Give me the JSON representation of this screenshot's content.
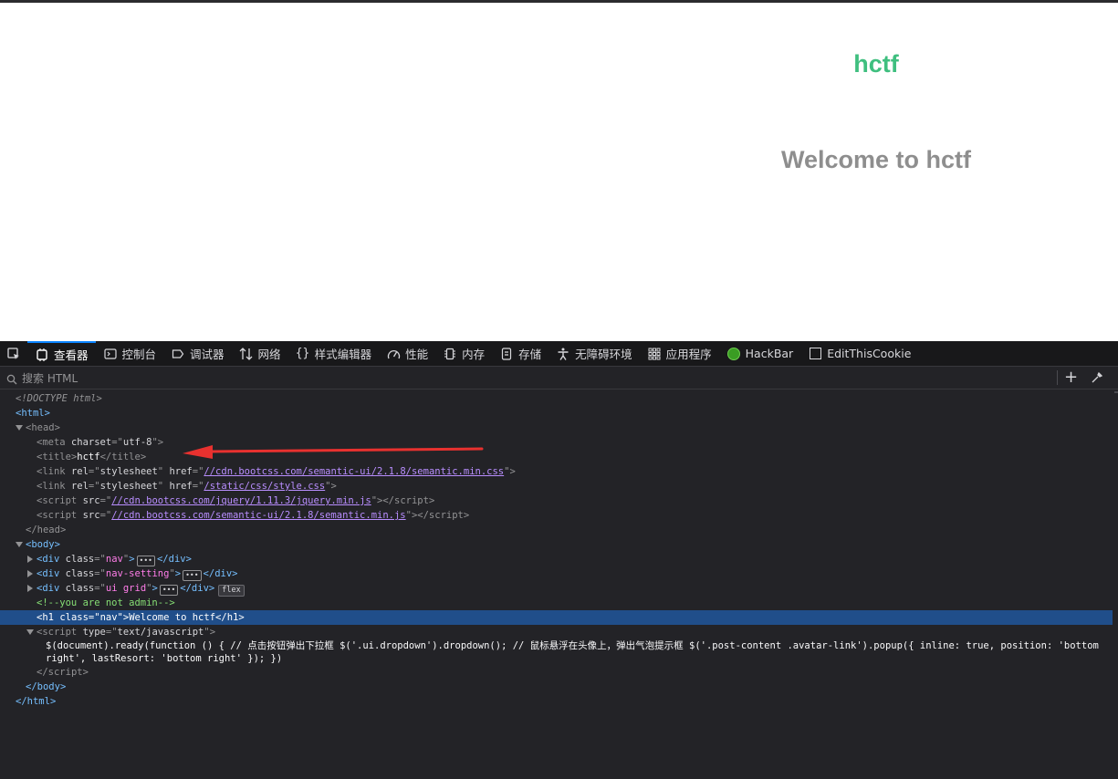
{
  "page": {
    "brand": "hctf",
    "heading": "Welcome to hctf",
    "colors": {
      "brand": "#3fbf7f",
      "heading": "#8e8e8e"
    }
  },
  "devtools": {
    "tabs": [
      {
        "label": "查看器",
        "icon": "inspector-icon",
        "active": true
      },
      {
        "label": "控制台",
        "icon": "console-icon"
      },
      {
        "label": "调试器",
        "icon": "debugger-icon"
      },
      {
        "label": "网络",
        "icon": "network-icon"
      },
      {
        "label": "样式编辑器",
        "icon": "style-editor-icon"
      },
      {
        "label": "性能",
        "icon": "performance-icon"
      },
      {
        "label": "内存",
        "icon": "memory-icon"
      },
      {
        "label": "存储",
        "icon": "storage-icon"
      },
      {
        "label": "无障碍环境",
        "icon": "accessibility-icon"
      },
      {
        "label": "应用程序",
        "icon": "application-icon"
      },
      {
        "label": "HackBar",
        "icon": "hackbar-icon"
      },
      {
        "label": "EditThisCookie",
        "icon": "cookie-icon"
      }
    ],
    "search": {
      "placeholder": "搜索 HTML"
    },
    "tree": {
      "doctype": "<!DOCTYPE html>",
      "t_html": "html",
      "t_head": "head",
      "t_meta": "meta",
      "a_charset": "charset",
      "v_charset": "utf-8",
      "t_title": "title",
      "title_text": "hctf",
      "t_link": "link",
      "a_rel": "rel",
      "v_stylesheet": "stylesheet",
      "a_href": "href",
      "v_css1": "//cdn.bootcss.com/semantic-ui/2.1.8/semantic.min.css",
      "v_css2": "/static/css/style.css",
      "t_script": "script",
      "a_src": "src",
      "v_js1": "//cdn.bootcss.com/jquery/1.11.3/jquery.min.js",
      "v_js2": "//cdn.bootcss.com/semantic-ui/2.1.8/semantic.min.js",
      "t_body": "body",
      "t_div": "div",
      "a_class": "class",
      "v_nav": "nav",
      "v_navsetting": "nav-setting",
      "v_uigrid": "ui grid",
      "ellipsis": "•••",
      "flex_badge": "flex",
      "comment": "<!--you are not admin-->",
      "t_h1": "h1",
      "h1_text": "Welcome to hctf",
      "a_type": "type",
      "v_type": "text/javascript",
      "script_code": "$(document).ready(function () { // 点击按钮弹出下拉框 $('.ui.dropdown').dropdown(); // 鼠标悬浮在头像上，弹出气泡提示框 $('.post-content .avatar-link').popup({ inline: true, position: 'bottom right', lastResort: 'bottom right' }); })"
    },
    "colors": {
      "selection": "#204e8a",
      "tag": "#75bfff",
      "attr_value": "#b98eff",
      "comment": "#86de74",
      "annotation_arrow": "#e8312f"
    }
  }
}
